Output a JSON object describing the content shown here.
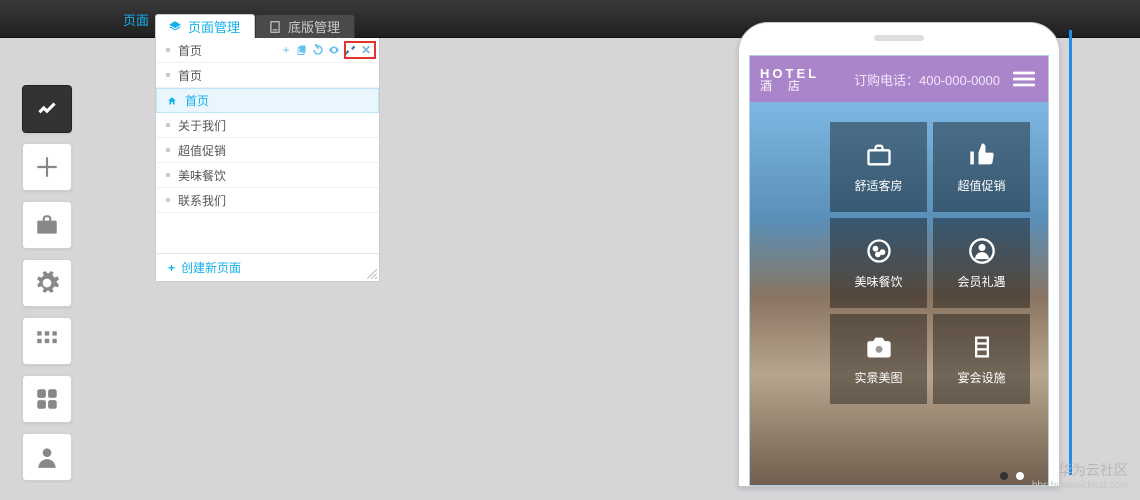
{
  "topbar": {
    "label": "页面"
  },
  "tabs": {
    "page_mgmt": "页面管理",
    "footer_mgmt": "底版管理"
  },
  "panel": {
    "items": [
      {
        "label": "首页"
      },
      {
        "label": "首页"
      },
      {
        "label": "首页"
      },
      {
        "label": "关于我们"
      },
      {
        "label": "超值促销"
      },
      {
        "label": "美味餐饮"
      },
      {
        "label": "联系我们"
      }
    ],
    "create_label": "创建新页面"
  },
  "row_actions": {
    "add": "+",
    "copy": "⧉",
    "redo": "↻",
    "view": "👁",
    "settings": "✖",
    "close": "✖"
  },
  "phone": {
    "hotel": "HOTEL",
    "hotel_cn": "酒　店",
    "phone_text": "订购电话：400-000-0000",
    "tiles": [
      {
        "label": "舒适客房"
      },
      {
        "label": "超值促销"
      },
      {
        "label": "美味餐饮"
      },
      {
        "label": "会员礼遇"
      },
      {
        "label": "实景美图"
      },
      {
        "label": "宴会设施"
      }
    ]
  },
  "watermark": {
    "line1": "华为云社区",
    "line2": "bbs.huaweicloud.com"
  }
}
